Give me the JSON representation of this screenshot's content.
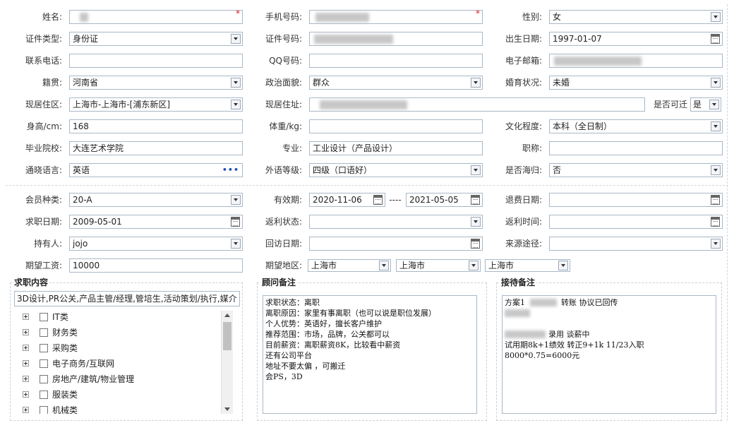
{
  "personal": {
    "name_label": "姓名:",
    "mobile_label": "手机号码:",
    "gender_label": "性别:",
    "gender_value": "女",
    "id_type_label": "证件类型:",
    "id_type_value": "身份证",
    "id_number_label": "证件号码:",
    "birth_label": "出生日期:",
    "birth_value": "1997-01-07",
    "phone_label": "联系电话:",
    "qq_label": "QQ号码:",
    "email_label": "电子邮箱:",
    "native_label": "籍贯:",
    "native_value": "河南省",
    "political_label": "政治面貌:",
    "political_value": "群众",
    "marital_label": "婚育状况:",
    "marital_value": "未婚",
    "residence_label": "现居住区:",
    "residence_value": "上海市-上海市-[浦东新区]",
    "address_label": "现居住址:",
    "relocate_label": "是否可迁",
    "relocate_value": "是",
    "height_label": "身高/cm:",
    "height_value": "168",
    "weight_label": "体重/kg:",
    "education_label": "文化程度:",
    "education_value": "本科（全日制）",
    "school_label": "毕业院校:",
    "school_value": "大连艺术学院",
    "major_label": "专业:",
    "major_value": "工业设计（产品设计）",
    "title_label": "职称:",
    "language_label": "通晓语言:",
    "language_value": "英语",
    "foreign_level_label": "外语等级:",
    "foreign_level_value": "四级（口语好）",
    "overseas_label": "是否海归:",
    "overseas_value": "否",
    "required_mark": "*"
  },
  "membership": {
    "type_label": "会员种类:",
    "type_value": "20-A",
    "valid_label": "有效期:",
    "valid_from": "2020-11-06",
    "valid_sep": "----",
    "valid_to": "2021-05-05",
    "refund_label": "退费日期:",
    "jobdate_label": "求职日期:",
    "jobdate_value": "2009-05-01",
    "rebate_status_label": "返利状态:",
    "rebate_time_label": "返利时间:",
    "holder_label": "持有人:",
    "holder_value": "jojo",
    "visit_label": "回访日期:",
    "source_label": "来源途径:",
    "salary_label": "期望工资:",
    "salary_value": "10000",
    "region_label": "期望地区:",
    "region_1": "上海市",
    "region_2": "上海市",
    "region_3": "上海市"
  },
  "job_content": {
    "title": "求职内容",
    "input_value": "3D设计,PR公关,产品主管/经理,管培生,活动策划/执行,媒介",
    "categories": [
      "IT类",
      "财务类",
      "采购类",
      "电子商务/互联网",
      "房地产/建筑/物业管理",
      "服装类",
      "机械类"
    ]
  },
  "advisor_notes": {
    "title": "顾问备注",
    "lines": [
      "求职状态：离职",
      "离职原因：家里有事离职（也可以说是职位发展）",
      "个人优势：英语好，擅长客户维护",
      "推荐范围：市场，品牌，公关都可以",
      "目前薪资：离职薪资8K，比较看中薪资",
      "还有公司平台",
      "地址不要太偏 ，可搬迁",
      "会PS，3D"
    ]
  },
  "reception_notes": {
    "title": "接待备注",
    "line1_prefix": "方案1",
    "line1_suffix": "转账 协议已回传",
    "line4_suffix": "录用 谈薪中",
    "line5": "试用期8k+1绩效  转正9+1k 11/23入职",
    "line6": "8000*0.75=6000元"
  }
}
